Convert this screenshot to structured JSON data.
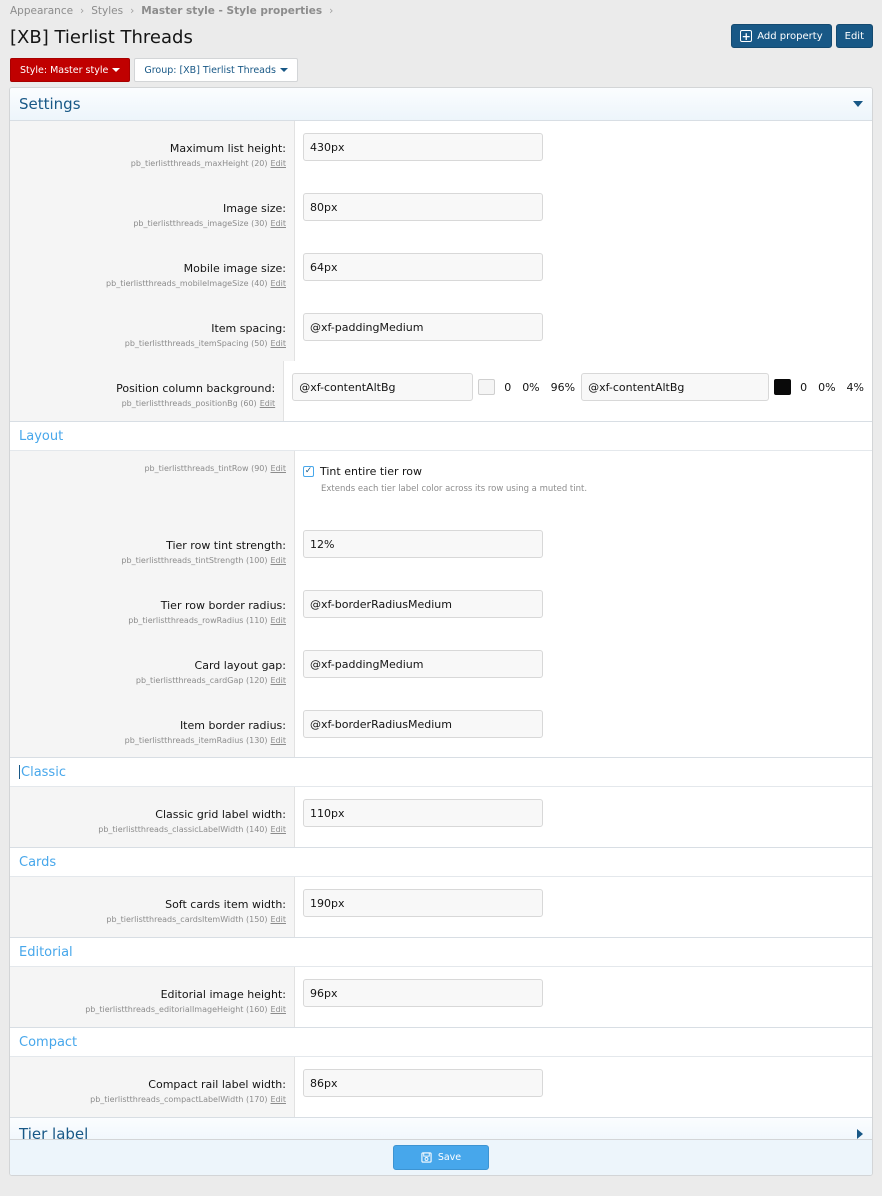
{
  "breadcrumb": {
    "items": [
      "Appearance",
      "Styles",
      "Master style - Style properties"
    ]
  },
  "page": {
    "title": "[XB] Tierlist Threads"
  },
  "toolbar": {
    "add_property_label": "Add property",
    "edit_label": "Edit"
  },
  "filters": {
    "style_label": "Style: Master style",
    "group_label": "Group: [XB] Tierlist Threads"
  },
  "colors": {
    "accent": "#185886",
    "link": "#47a7eb",
    "style_red": "#c00000"
  },
  "settings": {
    "title": "Settings",
    "rows": [
      {
        "label": "Maximum list height:",
        "meta": "pb_tierlistthreads_maxHeight (20)",
        "value": "430px"
      },
      {
        "label": "Image size:",
        "meta": "pb_tierlistthreads_imageSize (30)",
        "value": "80px"
      },
      {
        "label": "Mobile image size:",
        "meta": "pb_tierlistthreads_mobileImageSize (40)",
        "value": "64px"
      },
      {
        "label": "Item spacing:",
        "meta": "pb_tierlistthreads_itemSpacing (50)",
        "value": "@xf-paddingMedium"
      }
    ],
    "color_row": {
      "label": "Position column background:",
      "meta": "pb_tierlistthreads_positionBg (60)",
      "light": {
        "value": "@xf-contentAltBg",
        "swatch": "#f5f5f5",
        "h": "0",
        "s": "0%",
        "l": "96%"
      },
      "dark": {
        "value": "@xf-contentAltBg",
        "swatch": "#0a0a0a",
        "h": "0",
        "s": "0%",
        "l": "4%"
      }
    }
  },
  "layout": {
    "title": "Layout",
    "tint_row": {
      "meta": "pb_tierlistthreads_tintRow (90)",
      "checkbox_label": "Tint entire tier row",
      "checked": true,
      "description": "Extends each tier label color across its row using a muted tint."
    },
    "rows": [
      {
        "label": "Tier row tint strength:",
        "meta": "pb_tierlistthreads_tintStrength (100)",
        "value": "12%"
      },
      {
        "label": "Tier row border radius:",
        "meta": "pb_tierlistthreads_rowRadius (110)",
        "value": "@xf-borderRadiusMedium"
      },
      {
        "label": "Card layout gap:",
        "meta": "pb_tierlistthreads_cardGap (120)",
        "value": "@xf-paddingMedium"
      },
      {
        "label": "Item border radius:",
        "meta": "pb_tierlistthreads_itemRadius (130)",
        "value": "@xf-borderRadiusMedium"
      }
    ]
  },
  "classic": {
    "title": "Classic",
    "row": {
      "label": "Classic grid label width:",
      "meta": "pb_tierlistthreads_classicLabelWidth (140)",
      "value": "110px"
    }
  },
  "cards": {
    "title": "Cards",
    "row": {
      "label": "Soft cards item width:",
      "meta": "pb_tierlistthreads_cardsItemWidth (150)",
      "value": "190px"
    }
  },
  "editorial": {
    "title": "Editorial",
    "row": {
      "label": "Editorial image height:",
      "meta": "pb_tierlistthreads_editorialImageHeight (160)",
      "value": "96px"
    }
  },
  "compact": {
    "title": "Compact",
    "row": {
      "label": "Compact rail label width:",
      "meta": "pb_tierlistthreads_compactLabelWidth (170)",
      "value": "86px"
    }
  },
  "tier_label": {
    "title": "Tier label"
  },
  "edit_link_label": "Edit",
  "footer": {
    "save_label": "Save"
  }
}
